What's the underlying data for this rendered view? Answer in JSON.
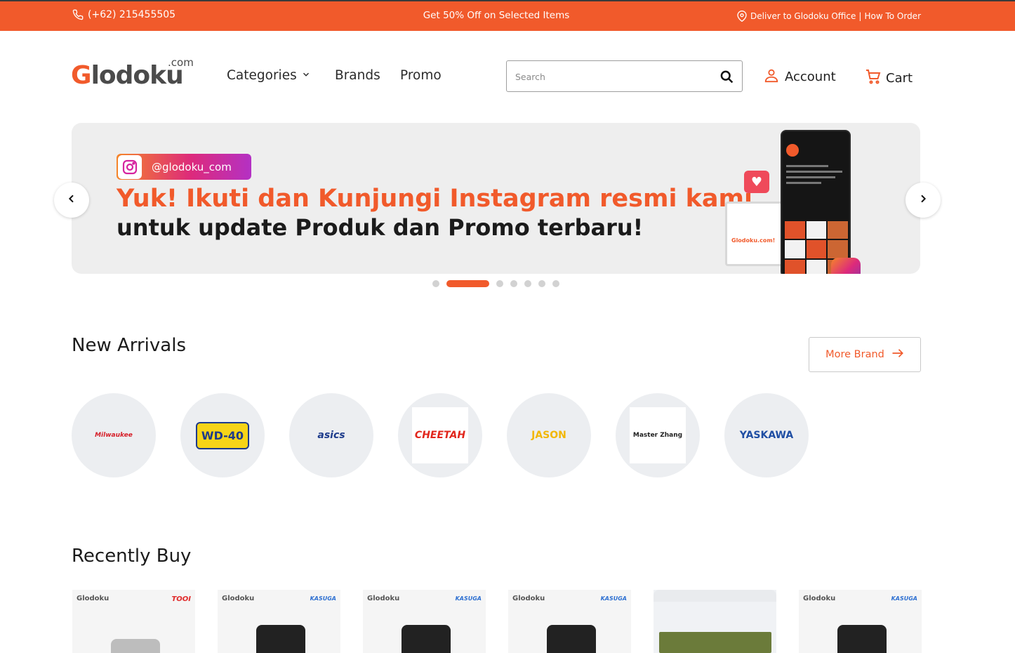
{
  "topbar": {
    "phone": "(+62) 215455505",
    "promo": "Get 50% Off on Selected Items",
    "deliver": "Deliver to Glodoku Office",
    "separator": "|",
    "how_to_order": "How To Order"
  },
  "header": {
    "logo_main_first": "G",
    "logo_main_rest": "lodoku",
    "logo_dotcom": ".com",
    "nav": {
      "categories": "Categories",
      "brands": "Brands",
      "promo": "Promo"
    },
    "search_placeholder": "Search",
    "account": "Account",
    "cart": "Cart"
  },
  "banner": {
    "handle": "@glodoku_com",
    "line1": "Yuk! Ikuti dan Kunjungi Instagram resmi kami",
    "line2": "untuk update Produk dan Promo terbaru!",
    "mock_text": "Glodoku.com!",
    "slide_count": 7,
    "active_slide": 1
  },
  "new_arrivals": {
    "title": "New Arrivals",
    "more_button": "More Brand",
    "brands": [
      {
        "name": "Milwaukee",
        "color": "#d6202a",
        "boxed": false
      },
      {
        "name": "WD-40",
        "color": "#1d3a8a",
        "boxed": false
      },
      {
        "name": "asics",
        "color": "#1e3c8c",
        "boxed": false
      },
      {
        "name": "CHEETAH",
        "color": "#e1251b",
        "boxed": true
      },
      {
        "name": "JASON",
        "color": "#f2b705",
        "boxed": false
      },
      {
        "name": "Master Zhang",
        "color": "#222222",
        "boxed": true
      },
      {
        "name": "YASKAWA",
        "color": "#1f4ea3",
        "boxed": false
      }
    ]
  },
  "recently_buy": {
    "title": "Recently Buy",
    "products": [
      {
        "store": "Glodoku",
        "brand": "TOOI",
        "blank": false
      },
      {
        "store": "Glodoku",
        "brand": "KASUGA",
        "blank": false
      },
      {
        "store": "Glodoku",
        "brand": "KASUGA",
        "blank": false
      },
      {
        "store": "Glodoku",
        "brand": "KASUGA",
        "blank": false
      },
      {
        "store": "",
        "brand": "",
        "blank": true
      },
      {
        "store": "Glodoku",
        "brand": "KASUGA",
        "blank": false
      }
    ]
  },
  "colors": {
    "brand_orange": "#f15a2b",
    "text_dark": "#1b1b1b"
  }
}
